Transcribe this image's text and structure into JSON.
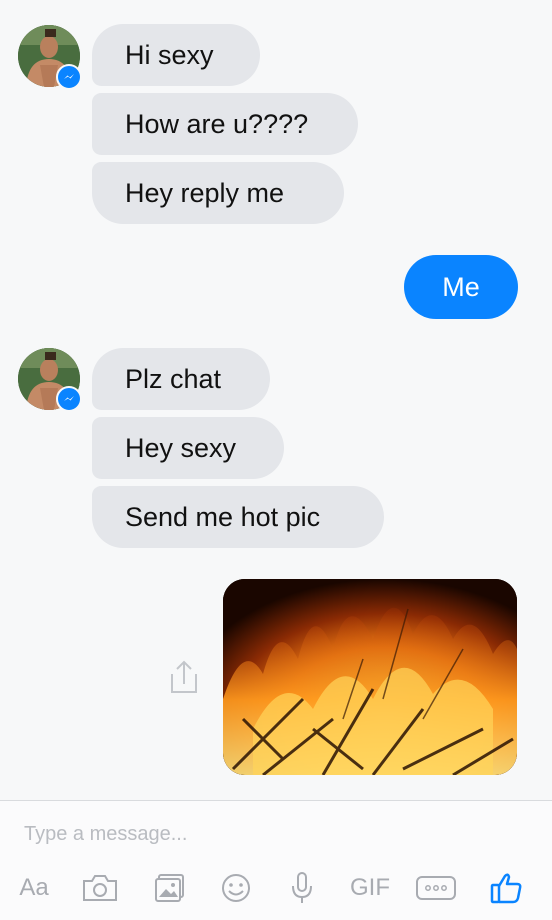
{
  "conversation": {
    "group_1": {
      "messages": [
        "Hi sexy",
        "How are u????",
        "Hey reply me"
      ]
    },
    "sent_text": "Me",
    "group_2": {
      "messages": [
        "Plz chat",
        "Hey sexy",
        "Send me hot pic"
      ]
    },
    "sent_image": {
      "subject": "fire"
    }
  },
  "composer": {
    "placeholder": "Type a message...",
    "toolbar": [
      {
        "name": "text-format-button",
        "label": "Aa"
      },
      {
        "name": "camera-icon",
        "label": ""
      },
      {
        "name": "gallery-icon",
        "label": ""
      },
      {
        "name": "emoji-icon",
        "label": ""
      },
      {
        "name": "microphone-icon",
        "label": ""
      },
      {
        "name": "gif-button",
        "label": "GIF"
      },
      {
        "name": "more-icon",
        "label": ""
      },
      {
        "name": "like-icon",
        "label": ""
      }
    ]
  },
  "colors": {
    "sent_bubble": "#0a84ff",
    "received_bubble": "#e4e6ea",
    "toolbar_icon": "#a8abb1",
    "like_icon": "#0a84ff"
  }
}
